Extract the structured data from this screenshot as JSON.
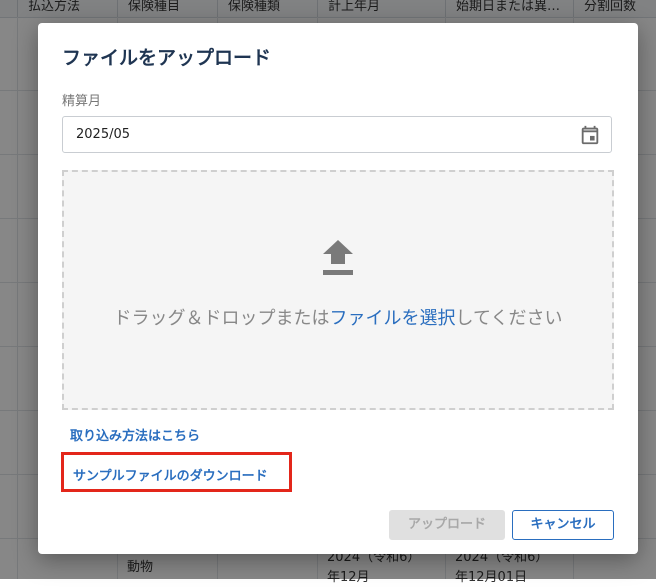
{
  "background_table": {
    "headers": [
      "払込方法",
      "保険種目",
      "保険種類",
      "計上年月",
      "始期日または異…",
      "分割回数"
    ],
    "visible_cells": [
      "動物",
      "2024（令和6）",
      "年12月",
      "2024（令和6）",
      "年12月01日"
    ]
  },
  "dialog": {
    "title": "ファイルをアップロード",
    "month_label": "精算月",
    "month_value": "2025/05",
    "dropzone": {
      "text_before": "ドラッグ＆ドロップまたは",
      "select_link": "ファイルを選択",
      "text_after": "してください"
    },
    "howto_link": "取り込み方法はこちら",
    "sample_link": "サンプルファイルのダウンロード",
    "upload_button": "アップロード",
    "cancel_button": "キャンセル"
  },
  "colors": {
    "accent": "#2a6ebf",
    "title": "#1f3552",
    "highlight": "#e3261a",
    "disabled_button": "#e0e0e0"
  },
  "icons": [
    "calendar-icon",
    "upload-icon"
  ]
}
